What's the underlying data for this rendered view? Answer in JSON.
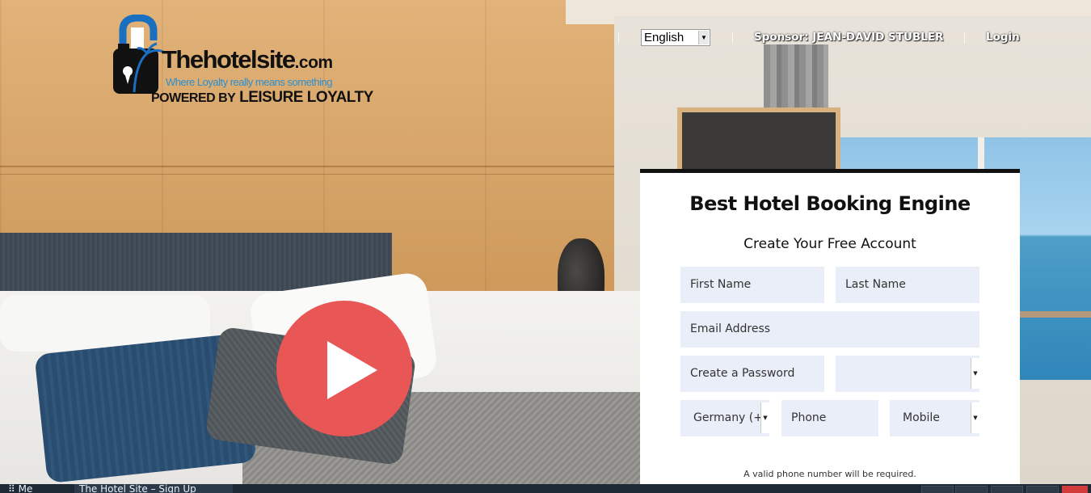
{
  "logo": {
    "name_main": "Thehotelsite",
    "name_suffix": ".com",
    "tagline": "Where Loyalty really means something",
    "powered_prefix": "POWERED BY",
    "powered_brand": "LEISURE LOYALTY"
  },
  "nav": {
    "language_selected": "English",
    "sponsor": "Sponsor: JEAN-DAVID STUBLER",
    "login": "Login"
  },
  "video": {
    "icon": "play-icon"
  },
  "signup": {
    "title": "Best Hotel Booking Engine",
    "subtitle": "Create Your Free Account",
    "fields": {
      "first_name": "First Name",
      "last_name": "Last Name",
      "email": "Email Address",
      "password": "Create a Password",
      "country_code": "Germany (+",
      "phone": "Phone",
      "phone_type": "Mobile"
    },
    "hint": "A valid phone number will be required."
  },
  "taskbar": {
    "start_label": "Me",
    "tab_title": "The Hotel Site – Sign Up"
  },
  "colors": {
    "play_button": "#e85656",
    "field_bg": "#e9eef8",
    "logo_blue": "#1a6fc0",
    "tagline_blue": "#2a8fd0"
  }
}
